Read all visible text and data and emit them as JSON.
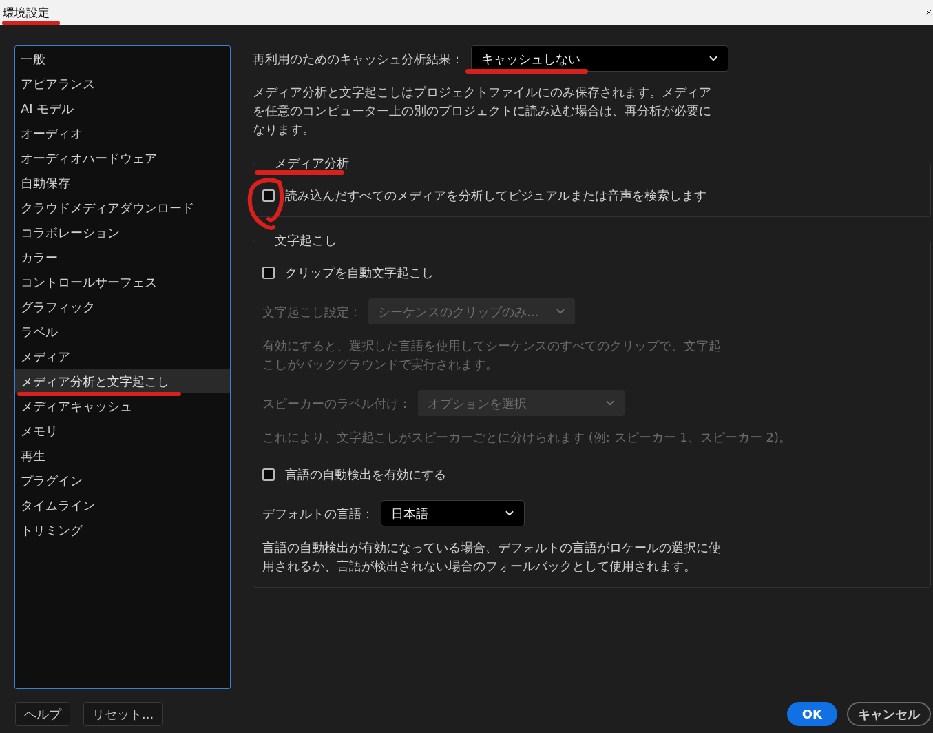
{
  "window": {
    "title": "環境設定",
    "underlined": true
  },
  "sidebar": {
    "items": [
      {
        "label": "一般",
        "selected": false,
        "underlined": false
      },
      {
        "label": "アピアランス",
        "selected": false,
        "underlined": false
      },
      {
        "label": "AI モデル",
        "selected": false,
        "underlined": false
      },
      {
        "label": "オーディオ",
        "selected": false,
        "underlined": false
      },
      {
        "label": "オーディオハードウェア",
        "selected": false,
        "underlined": false
      },
      {
        "label": "自動保存",
        "selected": false,
        "underlined": false
      },
      {
        "label": "クラウドメディアダウンロード",
        "selected": false,
        "underlined": false
      },
      {
        "label": "コラボレーション",
        "selected": false,
        "underlined": false
      },
      {
        "label": "カラー",
        "selected": false,
        "underlined": false
      },
      {
        "label": "コントロールサーフェス",
        "selected": false,
        "underlined": false
      },
      {
        "label": "グラフィック",
        "selected": false,
        "underlined": false
      },
      {
        "label": "ラベル",
        "selected": false,
        "underlined": false
      },
      {
        "label": "メディア",
        "selected": false,
        "underlined": false
      },
      {
        "label": "メディア分析と文字起こし",
        "selected": true,
        "underlined": true
      },
      {
        "label": "メディアキャッシュ",
        "selected": false,
        "underlined": false
      },
      {
        "label": "メモリ",
        "selected": false,
        "underlined": false
      },
      {
        "label": "再生",
        "selected": false,
        "underlined": false
      },
      {
        "label": "プラグイン",
        "selected": false,
        "underlined": false
      },
      {
        "label": "タイムライン",
        "selected": false,
        "underlined": false
      },
      {
        "label": "トリミング",
        "selected": false,
        "underlined": false
      }
    ]
  },
  "cache": {
    "label": "再利用のためのキャッシュ分析結果：",
    "value": "キャッシュしない",
    "underlined": true
  },
  "info": "メディア分析と文字起こしはプロジェクトファイルにのみ保存されます。メディアを任意のコンピューター上の別のプロジェクトに読み込む場合は、再分析が必要になります。",
  "groups": [
    {
      "title": "メディア分析",
      "underlined": true,
      "items": [
        {
          "kind": "checkbox",
          "label": "読み込んだすべてのメディアを分析してビジュアルまたは音声を検索します",
          "checked": false,
          "circled": true
        }
      ]
    },
    {
      "title": "文字起こし",
      "underlined": false,
      "items": [
        {
          "kind": "checkbox",
          "label": "クリップを自動文字起こし",
          "checked": false,
          "circled": false
        },
        {
          "kind": "select",
          "label": "文字起こし設定：",
          "value": "シーケンスのクリップのみ...",
          "disabled": true
        },
        {
          "kind": "note",
          "text": "有効にすると、選択した言語を使用してシーケンスのすべてのクリップで、文字起こしがバックグラウンドで実行されます。",
          "disabled": true
        },
        {
          "kind": "select",
          "label": "スピーカーのラベル付け：",
          "value": "オプションを選択",
          "disabled": true
        },
        {
          "kind": "note",
          "text": "これにより、文字起こしがスピーカーごとに分けられます (例: スピーカー 1、スピーカー 2)。",
          "disabled": true
        },
        {
          "kind": "checkbox",
          "label": "言語の自動検出を有効にする",
          "checked": false,
          "circled": false
        },
        {
          "kind": "select",
          "label": "デフォルトの言語：",
          "value": "日本語",
          "disabled": false
        },
        {
          "kind": "note",
          "text": "言語の自動検出が有効になっている場合、デフォルトの言語がロケールの選択に使用されるか、言語が検出されない場合のフォールバックとして使用されます。",
          "disabled": false
        }
      ]
    }
  ],
  "footer": {
    "buttons": [
      {
        "label": "ヘルプ",
        "kind": "secondary"
      },
      {
        "label": "リセット...",
        "kind": "secondary"
      },
      {
        "label": "OK",
        "kind": "primary"
      },
      {
        "label": "キャンセル",
        "kind": "outline"
      }
    ]
  }
}
